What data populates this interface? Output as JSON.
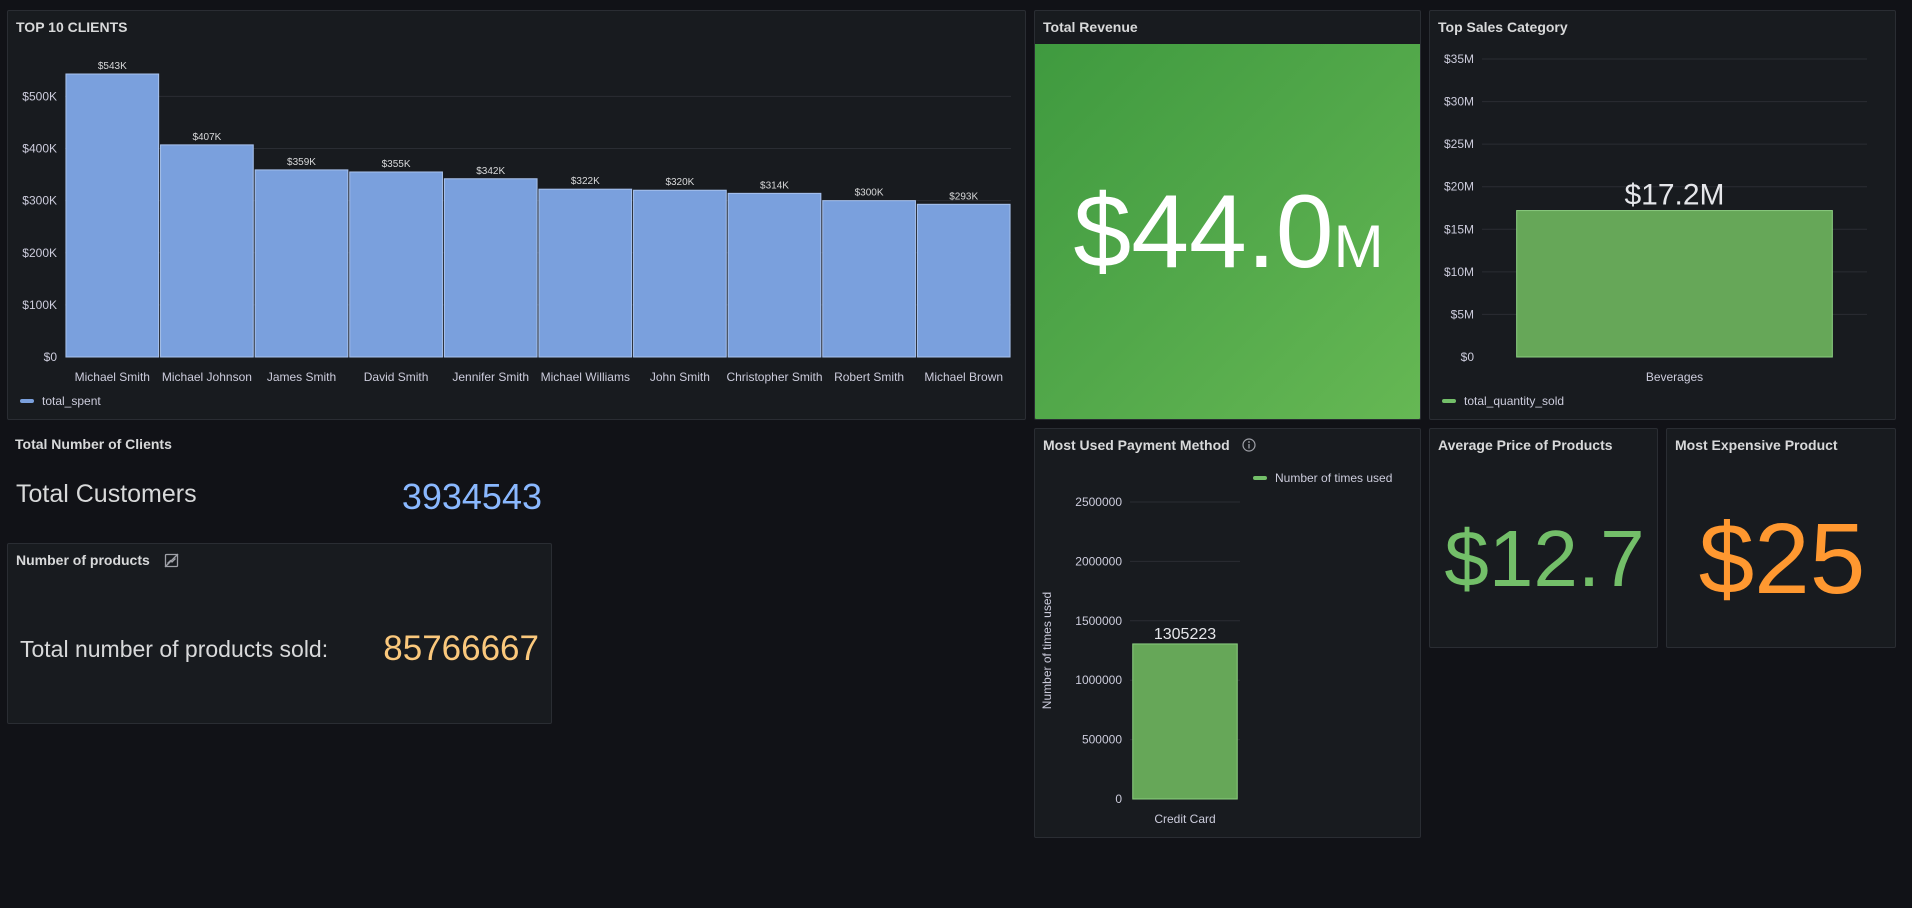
{
  "colors": {
    "blue_bar": "#7aa0dd",
    "green_bar": "#66a758",
    "green_stat": "#73bf69",
    "orange_stat": "#ff9830",
    "yellow_stat": "#fac87c",
    "blue_stat": "#8ab8ff"
  },
  "top_clients": {
    "title": "TOP 10 CLIENTS",
    "legend": "total_spent",
    "chart_data": {
      "type": "bar",
      "categories": [
        "Michael Smith",
        "Michael Johnson",
        "James Smith",
        "David Smith",
        "Jennifer Smith",
        "Michael Williams",
        "John Smith",
        "Christopher Smith",
        "Robert Smith",
        "Michael Brown"
      ],
      "series": [
        {
          "name": "total_spent",
          "values": [
            543000,
            407000,
            359000,
            355000,
            342000,
            322000,
            320000,
            314000,
            300000,
            293000
          ]
        }
      ],
      "value_labels": [
        "$543K",
        "$407K",
        "$359K",
        "$355K",
        "$342K",
        "$322K",
        "$320K",
        "$314K",
        "$300K",
        "$293K"
      ],
      "yticks": [
        0,
        100000,
        200000,
        300000,
        400000,
        500000
      ],
      "ytick_labels": [
        "$0",
        "$100K",
        "$200K",
        "$300K",
        "$400K",
        "$500K"
      ],
      "ylim": [
        0,
        543000
      ],
      "grid": true,
      "legend_position": "bottom-left"
    }
  },
  "total_revenue": {
    "title": "Total Revenue",
    "value": "$44.0",
    "unit": "M"
  },
  "top_sales_category": {
    "title": "Top Sales Category",
    "legend": "total_quantity_sold",
    "chart_data": {
      "type": "bar",
      "categories": [
        "Beverages"
      ],
      "series": [
        {
          "name": "total_quantity_sold",
          "values": [
            17200000
          ]
        }
      ],
      "value_labels": [
        "$17.2M"
      ],
      "yticks": [
        0,
        5000000,
        10000000,
        15000000,
        20000000,
        25000000,
        30000000,
        35000000
      ],
      "ytick_labels": [
        "$0",
        "$5M",
        "$10M",
        "$15M",
        "$20M",
        "$25M",
        "$30M",
        "$35M"
      ],
      "ylim": [
        0,
        35000000
      ],
      "grid": true,
      "legend_position": "bottom-left"
    }
  },
  "total_clients": {
    "title": "Total Number of Clients",
    "label": "Total Customers",
    "value": "3934543"
  },
  "num_products": {
    "title": "Number of products",
    "label": "Total number of products sold:",
    "value": "85766667"
  },
  "payment_method": {
    "title": "Most Used Payment Method",
    "legend": "Number of times used",
    "chart_data": {
      "type": "bar",
      "categories": [
        "Credit Card"
      ],
      "series": [
        {
          "name": "Number of times used",
          "values": [
            1305223
          ]
        }
      ],
      "value_labels": [
        "1305223"
      ],
      "yticks": [
        0,
        500000,
        1000000,
        1500000,
        2000000,
        2500000
      ],
      "ytick_labels": [
        "0",
        "500000",
        "1000000",
        "1500000",
        "2000000",
        "2500000"
      ],
      "ylim": [
        0,
        2500000
      ],
      "ylabel": "Number of times used",
      "grid": true,
      "legend_position": "top-right"
    }
  },
  "avg_price": {
    "title": "Average Price of Products",
    "value": "$12.7"
  },
  "most_expensive": {
    "title": "Most Expensive Product",
    "value": "$25"
  }
}
